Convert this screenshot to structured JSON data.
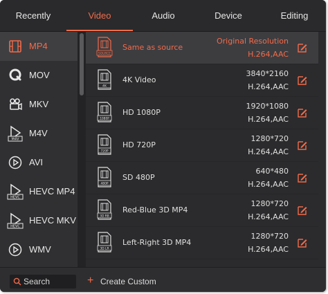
{
  "tabs": [
    {
      "label": "Recently"
    },
    {
      "label": "Video"
    },
    {
      "label": "Audio"
    },
    {
      "label": "Device"
    },
    {
      "label": "Editing"
    }
  ],
  "active_tab": "Video",
  "sidebar": {
    "items": [
      {
        "label": "MP4",
        "icon": "film-icon"
      },
      {
        "label": "MOV",
        "icon": "quicktime-icon"
      },
      {
        "label": "MKV",
        "icon": "camera-icon"
      },
      {
        "label": "M4V",
        "icon": "m4v-play-icon"
      },
      {
        "label": "AVI",
        "icon": "play-circle-icon"
      },
      {
        "label": "HEVC MP4",
        "icon": "hevc-play-icon"
      },
      {
        "label": "HEVC MKV",
        "icon": "hevc-play-icon"
      },
      {
        "label": "WMV",
        "icon": "play-circle-icon"
      }
    ]
  },
  "presets": [
    {
      "name": "Same as source",
      "resolution": "Original Resolution",
      "codec": "H.264,AAC",
      "badge": "SOURCE"
    },
    {
      "name": "4K Video",
      "resolution": "3840*2160",
      "codec": "H.264,AAC",
      "badge": "4K"
    },
    {
      "name": "HD 1080P",
      "resolution": "1920*1080",
      "codec": "H.264,AAC",
      "badge": "1080P"
    },
    {
      "name": "HD 720P",
      "resolution": "1280*720",
      "codec": "H.264,AAC",
      "badge": "720P"
    },
    {
      "name": "SD 480P",
      "resolution": "640*480",
      "codec": "H.264,AAC",
      "badge": "480P"
    },
    {
      "name": "Red-Blue 3D MP4",
      "resolution": "1280*720",
      "codec": "H.264,AAC",
      "badge": "3D RB"
    },
    {
      "name": "Left-Right 3D MP4",
      "resolution": "1280*720",
      "codec": "H.264,AAC",
      "badge": "3D LR"
    }
  ],
  "search": {
    "placeholder": "Search"
  },
  "create_custom": {
    "label": "Create Custom"
  },
  "colors": {
    "accent": "#f26b4a",
    "background": "#2b2b2d",
    "sidebar": "#303032"
  }
}
